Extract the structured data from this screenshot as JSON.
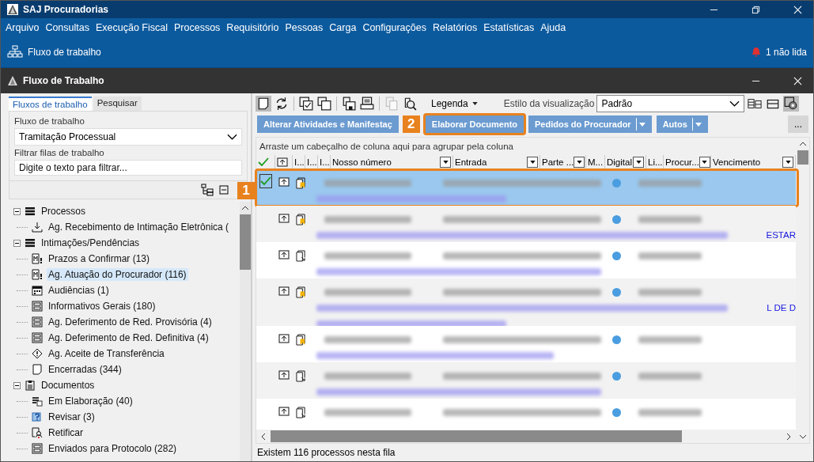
{
  "app": {
    "title": "SAJ Procuradorias"
  },
  "menu": [
    "Arquivo",
    "Consultas",
    "Execução Fiscal",
    "Processos",
    "Requisitório",
    "Pessoas",
    "Carga",
    "Configurações",
    "Relatórios",
    "Estatísticas",
    "Ajuda"
  ],
  "module_bar": {
    "module": "Fluxo de trabalho",
    "notifications": "1 não lida"
  },
  "document_window": {
    "title": "Fluxo de Trabalho"
  },
  "left_panel": {
    "tabs": [
      {
        "label": "Fluxos de trabalho",
        "selected": true
      },
      {
        "label": "Pesquisar",
        "selected": false
      }
    ],
    "workflow_label": "Fluxo de trabalho",
    "workflow_value": "Tramitação Processual",
    "filter_label": "Filtrar filas de trabalho",
    "filter_placeholder": "Digite o texto para filtrar...",
    "tree": [
      {
        "label": "Processos",
        "kind": "stack",
        "expanded": true,
        "selected": false,
        "children": [
          {
            "label": "Ag. Recebimento de Intimação Eletrônica (",
            "kind": "download",
            "selected": false
          }
        ]
      },
      {
        "label": "Intimações/Pendências",
        "kind": "stack",
        "expanded": true,
        "selected": false,
        "children": [
          {
            "label": "Prazos a Confirmar (13)",
            "kind": "mdoc",
            "selected": false
          },
          {
            "label": "Ag. Atuação do Procurador (116)",
            "kind": "mdoc",
            "selected": true
          },
          {
            "label": "Audiências (1)",
            "kind": "calendar",
            "selected": false
          },
          {
            "label": "Informativos Gerais (180)",
            "kind": "form",
            "selected": false
          },
          {
            "label": "Ag. Deferimento de Red. Provisória (4)",
            "kind": "form",
            "selected": false
          },
          {
            "label": "Ag. Deferimento de Red. Definitiva (4)",
            "kind": "form",
            "selected": false
          },
          {
            "label": "Ag. Aceite de Transferência",
            "kind": "warning",
            "selected": false
          },
          {
            "label": "Encerradas (344)",
            "kind": "page",
            "selected": false
          }
        ]
      },
      {
        "label": "Documentos",
        "kind": "clipboard",
        "expanded": true,
        "selected": false,
        "children": [
          {
            "label": "Em Elaboração (40)",
            "kind": "listdoc",
            "selected": false
          },
          {
            "label": "Revisar (3)",
            "kind": "help",
            "selected": false
          },
          {
            "label": "Retificar",
            "kind": "rectify",
            "selected": false
          },
          {
            "label": "Enviados para Protocolo (282)",
            "kind": "form",
            "selected": false
          }
        ]
      }
    ]
  },
  "right_panel": {
    "legend": "Legenda",
    "view_style_label": "Estilo da visualização",
    "view_style_value": "Padrão",
    "actions": [
      {
        "label": "Alterar Atividades e Manifestaç",
        "dropdown": false
      },
      {
        "label": "Elaborar Documento",
        "dropdown": false,
        "callout": "2"
      },
      {
        "label": "Pedidos do Procurador",
        "dropdown": true
      },
      {
        "label": "Autos",
        "dropdown": true
      }
    ],
    "more": "...",
    "group_hint": "Arraste um cabeçalho de coluna aqui para agrupar pela coluna",
    "columns": [
      {
        "label": "I...",
        "filter": false
      },
      {
        "label": "I...",
        "filter": false
      },
      {
        "label": "I...",
        "filter": false
      },
      {
        "label": "Nosso número",
        "filter": true
      },
      {
        "label": "Entrada",
        "filter": true
      },
      {
        "label": "Parte ...",
        "filter": true
      },
      {
        "label": "M...",
        "filter": false
      },
      {
        "label": "Digital",
        "filter": true
      },
      {
        "label": "Li...",
        "filter": false
      },
      {
        "label": "Procur...",
        "filter": true
      },
      {
        "label": "Vencimento",
        "filter": true
      }
    ],
    "rows": [
      {
        "selected": true,
        "kind": "bookmark",
        "callout": "1"
      },
      {
        "selected": false,
        "kind": "bookmark",
        "tail": "ESTAR"
      },
      {
        "selected": false,
        "kind": "arrow"
      },
      {
        "selected": false,
        "kind": "bookmark",
        "tail": "L DE D"
      },
      {
        "selected": false,
        "kind": "bookmark"
      },
      {
        "selected": false,
        "kind": "arrow"
      },
      {
        "selected": false,
        "kind": "arrow"
      }
    ],
    "status": "Existem 116 processos nesta fila"
  }
}
